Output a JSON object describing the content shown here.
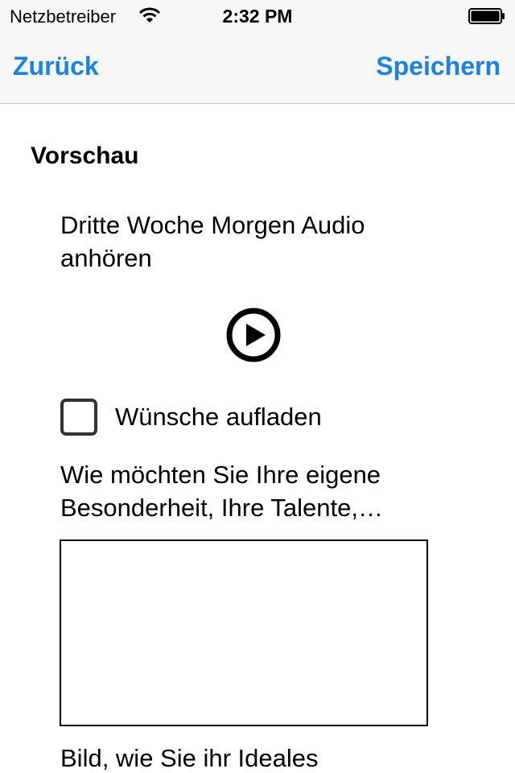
{
  "status_bar": {
    "carrier": "Netzbetreiber",
    "time": "2:32 PM",
    "wifi_icon": "wifi-icon",
    "battery_icon": "battery-icon"
  },
  "nav": {
    "back_label": "Zurück",
    "save_label": "Speichern",
    "accent_color": "#1a82e6"
  },
  "preview": {
    "title": "Vorschau",
    "audio_text": "Dritte Woche Morgen Audio anhören",
    "play_icon": "play-icon",
    "checkbox_label": "Wünsche aufladen",
    "checkbox_checked": false,
    "question_1": "Wie möchten Sie Ihre eigene Besonderheit, Ihre Talente,…",
    "answer_1_value": "",
    "question_2": "Bild, wie Sie ihr Ideales"
  }
}
